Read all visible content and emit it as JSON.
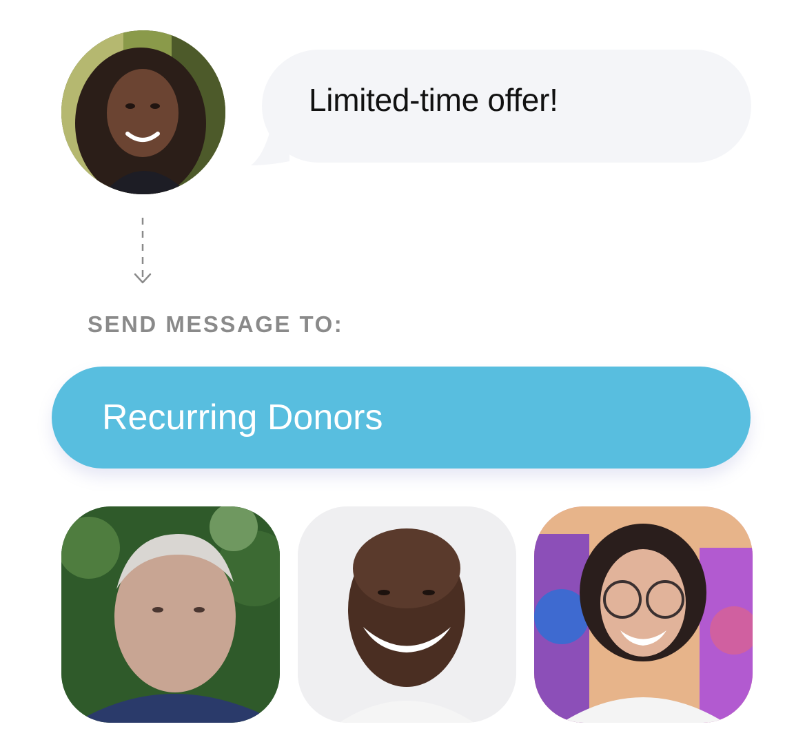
{
  "message": {
    "text": "Limited-time offer!"
  },
  "sender": {
    "avatar_icon": "person-photo"
  },
  "arrow_icon": "dashed-down-arrow-icon",
  "audience": {
    "label": "SEND MESSAGE TO:",
    "segment": "Recurring Donors",
    "accent_color": "#58bedf"
  },
  "recipients": [
    {
      "icon": "person-photo"
    },
    {
      "icon": "person-photo"
    },
    {
      "icon": "person-photo"
    }
  ]
}
